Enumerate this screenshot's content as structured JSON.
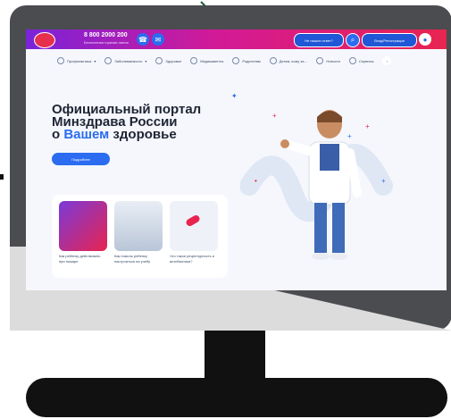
{
  "topbar": {
    "phone": "8 800 2000 200",
    "phone_sub": "Бесплатная горячая линия",
    "btn_question": "Не нашли ответ?",
    "btn_login": "Вход/Регистрация"
  },
  "nav": {
    "items": [
      {
        "label": "Профилактика",
        "has_dropdown": true
      },
      {
        "label": "Заболеваемость",
        "has_dropdown": true
      },
      {
        "label": "Здоровье"
      },
      {
        "label": "Медикаменты"
      },
      {
        "label": "Родителям"
      },
      {
        "label": "Детям, кому за…"
      },
      {
        "label": "Новости"
      },
      {
        "label": "Сервисы"
      }
    ]
  },
  "hero": {
    "line1": "Официальный портал",
    "line2": "Минздрава России",
    "line3_prefix": "о ",
    "line3_accent": "Вашем",
    "line3_suffix": " здоровье",
    "cta": "Подробнее"
  },
  "cards": [
    {
      "caption": "Как ребенку действовать при пожаре",
      "color": "#d83a6b"
    },
    {
      "caption": "Как помочь ребенку настроиться на учебу",
      "color": "#cfd8e6"
    },
    {
      "caption": "Что такое рецептурность и антибиотики?",
      "color": "#e8eef6"
    }
  ],
  "colors": {
    "accent": "#2b6cf0",
    "gradient_start": "#7a23d9",
    "gradient_end": "#e8244f",
    "arrow": "#1e5d3a"
  }
}
